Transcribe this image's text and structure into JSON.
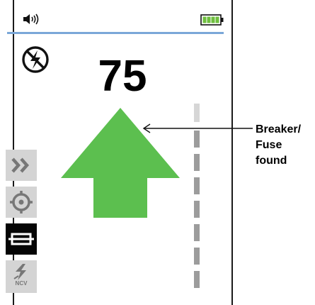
{
  "status_bar": {
    "speaker_icon": "speaker-volume-icon",
    "battery_icon": "battery-full-icon",
    "battery_color": "#6fbf3f",
    "divider_color": "#7aa7d8"
  },
  "indicator": {
    "no_power_icon": "no-lightning-icon",
    "reading": "75",
    "arrow_color": "#5cbf4f",
    "arrow_direction": "up"
  },
  "modes": {
    "items": [
      {
        "icon": "double-chevron-right-icon",
        "state": "inactive"
      },
      {
        "icon": "crosshair-target-icon",
        "state": "inactive"
      },
      {
        "icon": "fuse-icon",
        "state": "active"
      },
      {
        "icon": "ncv-lightning-icon",
        "label": "NCV",
        "state": "inactive"
      }
    ]
  },
  "signal_bar": {
    "segments_total": 8,
    "segments_lit": 7,
    "lit_color": "#9c9c9c",
    "unlit_color": "#d6d6d6"
  },
  "callout": {
    "text": "Breaker/\nFuse\nfound"
  }
}
